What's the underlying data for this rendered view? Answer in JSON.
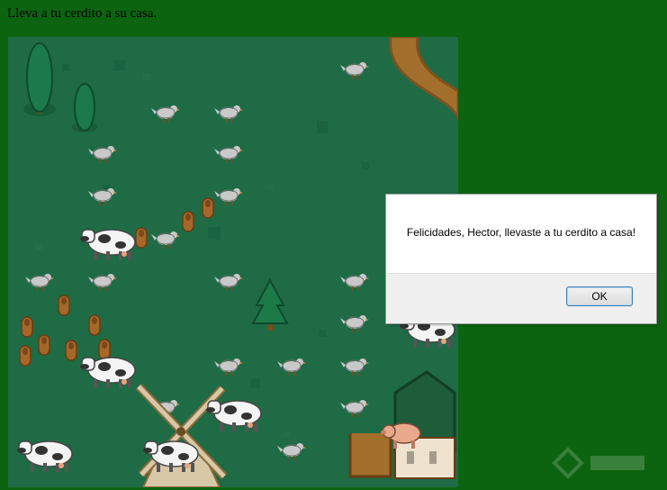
{
  "instructions": "Lleva a tu cerdito a su casa.",
  "dialog": {
    "message": "Felicidades, Hector, llevaste a tu cerdito a casa!",
    "ok_label": "OK"
  },
  "colors": {
    "page_background": "#0d6410",
    "grass": "#1e6b45",
    "path": "#a36f2c",
    "barn_roof": "#1e5c3a"
  },
  "board": {
    "grid_cells": 8,
    "player": "pig",
    "goal": "barn"
  },
  "icons": [
    "chicken-icon",
    "cow-icon",
    "tree-icon",
    "log-icon",
    "windmill-icon",
    "barn-icon",
    "pig-icon"
  ]
}
